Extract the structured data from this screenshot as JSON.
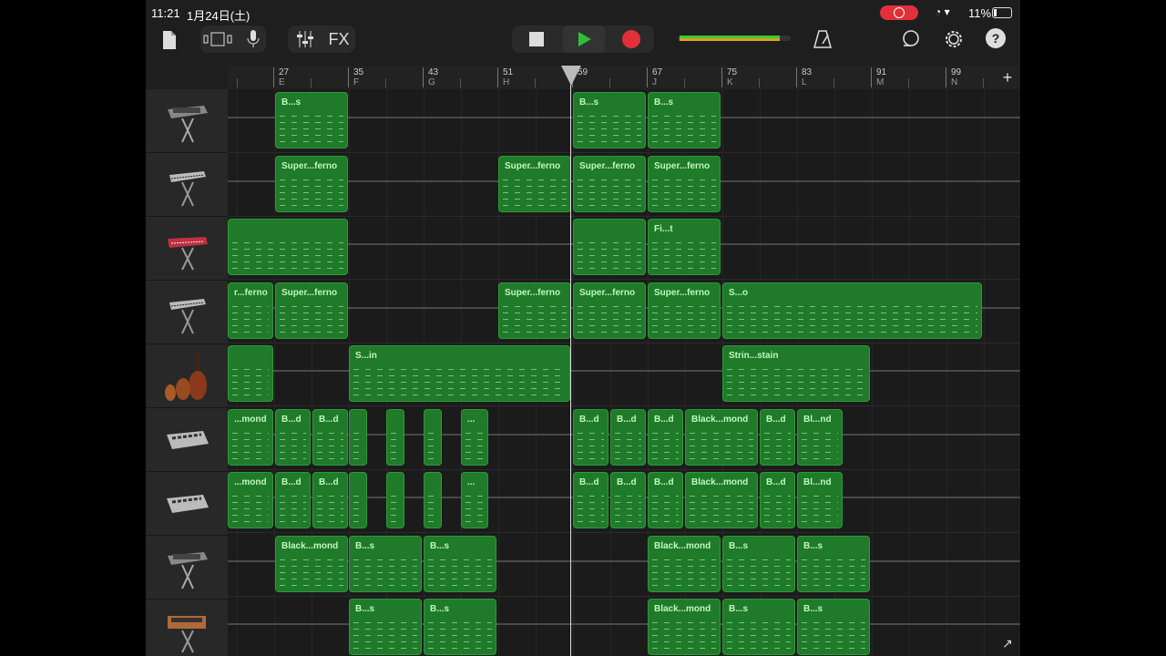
{
  "status": {
    "time": "11:21",
    "date": "1月24日(土)",
    "battery": "11%"
  },
  "toolbar": {
    "fx_label": "FX",
    "icons": [
      "document-icon",
      "tracks-view-icon",
      "microphone-icon",
      "mixer-icon",
      "stop-icon",
      "play-icon",
      "record-icon",
      "metronome-icon",
      "loop-icon",
      "settings-icon",
      "help-icon"
    ]
  },
  "ruler": {
    "bars": [
      {
        "num": "27",
        "sec": "E"
      },
      {
        "num": "35",
        "sec": "F"
      },
      {
        "num": "43",
        "sec": "G"
      },
      {
        "num": "51",
        "sec": "H"
      },
      {
        "num": "59",
        "sec": ""
      },
      {
        "num": "67",
        "sec": "J"
      },
      {
        "num": "75",
        "sec": "K"
      },
      {
        "num": "83",
        "sec": "L"
      },
      {
        "num": "91",
        "sec": "M"
      },
      {
        "num": "99",
        "sec": "N"
      }
    ],
    "add_label": "+"
  },
  "tracks": [
    {
      "instrument": "synth-keyboard-icon",
      "regions": [
        {
          "name": "B...s"
        },
        {
          "name": "B...s"
        },
        {
          "name": "B...s"
        }
      ]
    },
    {
      "instrument": "keyboard-stand-icon",
      "regions": [
        {
          "name": "Super...ferno"
        },
        {
          "name": "Super...ferno"
        },
        {
          "name": "Super...ferno"
        },
        {
          "name": "Super...ferno"
        }
      ]
    },
    {
      "instrument": "red-keyboard-icon",
      "regions": [
        {
          "name": ""
        },
        {
          "name": ""
        },
        {
          "name": "Fi...t"
        }
      ]
    },
    {
      "instrument": "keyboard-stand-icon",
      "regions": [
        {
          "name": "r...ferno"
        },
        {
          "name": "Super...ferno"
        },
        {
          "name": "Super...ferno"
        },
        {
          "name": "Super...ferno"
        },
        {
          "name": "Super...ferno"
        },
        {
          "name": "S...o"
        }
      ]
    },
    {
      "instrument": "strings-icon",
      "regions": [
        {
          "name": ""
        },
        {
          "name": "S...in"
        },
        {
          "name": "Strin...stain"
        }
      ]
    },
    {
      "instrument": "drum-machine-icon",
      "regions": [
        {
          "name": "...mond"
        },
        {
          "name": "B...d"
        },
        {
          "name": "B...d"
        },
        {
          "name": ""
        },
        {
          "name": ""
        },
        {
          "name": ""
        },
        {
          "name": "..."
        },
        {
          "name": "B...d"
        },
        {
          "name": "B...d"
        },
        {
          "name": "B...d"
        },
        {
          "name": "Black...mond"
        },
        {
          "name": "B...d"
        },
        {
          "name": "Bl...nd"
        }
      ]
    },
    {
      "instrument": "drum-machine-icon",
      "regions": [
        {
          "name": "...mond"
        },
        {
          "name": "B...d"
        },
        {
          "name": "B...d"
        },
        {
          "name": ""
        },
        {
          "name": ""
        },
        {
          "name": ""
        },
        {
          "name": "..."
        },
        {
          "name": "B...d"
        },
        {
          "name": "B...d"
        },
        {
          "name": "B...d"
        },
        {
          "name": "Black...mond"
        },
        {
          "name": "B...d"
        },
        {
          "name": "Bl...nd"
        }
      ]
    },
    {
      "instrument": "synth-keyboard-icon",
      "regions": [
        {
          "name": "Black...mond"
        },
        {
          "name": "B...s"
        },
        {
          "name": "B...s"
        },
        {
          "name": "Black...mond"
        },
        {
          "name": "B...s"
        },
        {
          "name": "B...s"
        }
      ]
    },
    {
      "instrument": "analog-synth-icon",
      "regions": [
        {
          "name": "B...s"
        },
        {
          "name": "B...s"
        },
        {
          "name": "Black...mond"
        },
        {
          "name": "B...s"
        },
        {
          "name": "B...s"
        }
      ]
    }
  ],
  "colors": {
    "region": "#1f7a2a",
    "region_border": "#2e9a3a",
    "record": "#e0303a",
    "play": "#2fbf3a"
  }
}
